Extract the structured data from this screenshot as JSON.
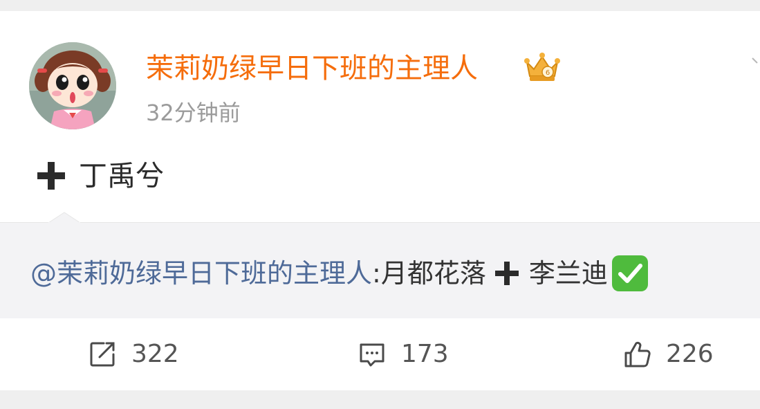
{
  "post": {
    "author": {
      "name": "茉莉奶绿早日下班的主理人",
      "badge_icon": "crown-badge-icon"
    },
    "timestamp": "32分钟前",
    "text": "丁禹兮",
    "text_prefix_icon": "plus-icon",
    "colors": {
      "author": "#f56d0c",
      "mention": "#4e6a98",
      "timestamp": "#9b9b9b"
    }
  },
  "repost": {
    "mention": "@茉莉奶绿早日下班的主理人",
    "text_before": ":月都花落",
    "text_after": "李兰迪",
    "plus_icon": "plus-icon",
    "check_icon": "check-mark-button-icon"
  },
  "actions": {
    "repost_count": "322",
    "comment_count": "173",
    "like_count": "226"
  }
}
